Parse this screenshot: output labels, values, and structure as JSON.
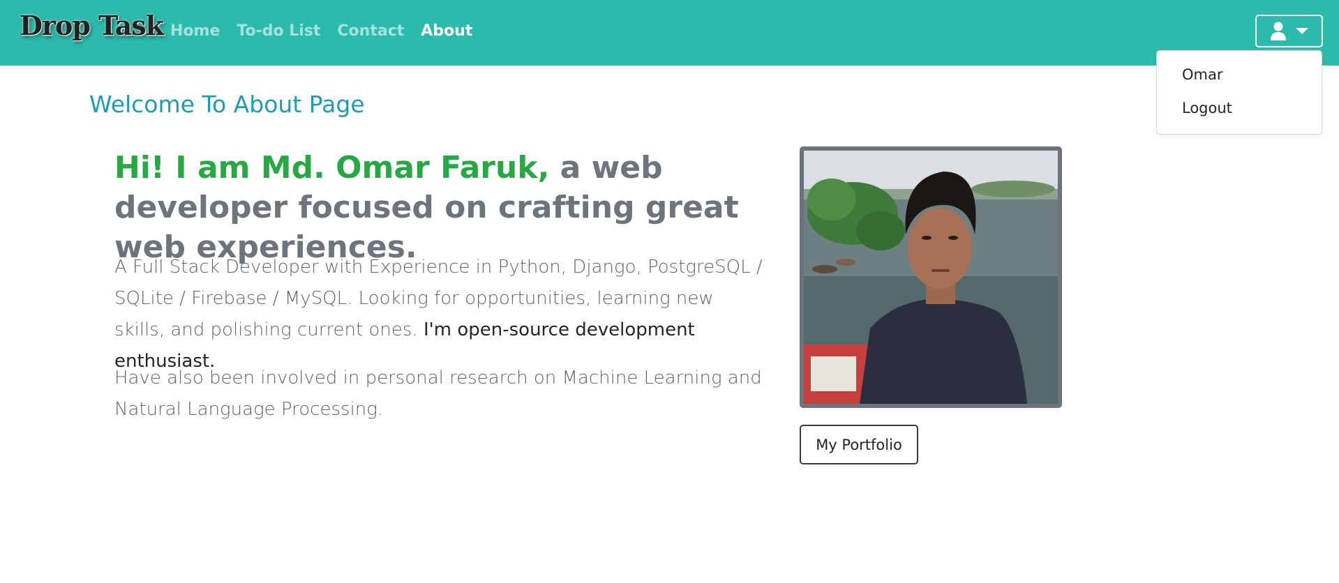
{
  "navbar": {
    "brand": "Drop Task",
    "links": [
      {
        "label": "Home",
        "active": false
      },
      {
        "label": "To-do List",
        "active": false
      },
      {
        "label": "Contact",
        "active": false
      },
      {
        "label": "About",
        "active": true
      }
    ],
    "user_menu": {
      "icon": "user-icon",
      "caret_icon": "caret-down-icon",
      "items": [
        "Omar",
        "Logout"
      ]
    }
  },
  "main": {
    "page_title": "Welcome To About Page",
    "headline_highlight": "Hi! I am Md. Omar Faruk,",
    "headline_rest": " a web developer focused on crafting great web experiences.",
    "paragraph1_main": "A Full Stack Developer with Experience in Python, Django, PostgreSQL / SQLite / Firebase / MySQL. Looking for opportunities, learning new skills, and polishing current ones.",
    "paragraph1_strong": "I'm open-source development enthusiast.",
    "paragraph2": "Have also been involved in personal research on Machine Learning and Natural Language Processing.",
    "portfolio_button": "My Portfolio"
  },
  "colors": {
    "navbar_bg": "#2bbbad",
    "title": "#1e9bb5",
    "highlight": "#28a745",
    "muted": "#6c757d"
  }
}
